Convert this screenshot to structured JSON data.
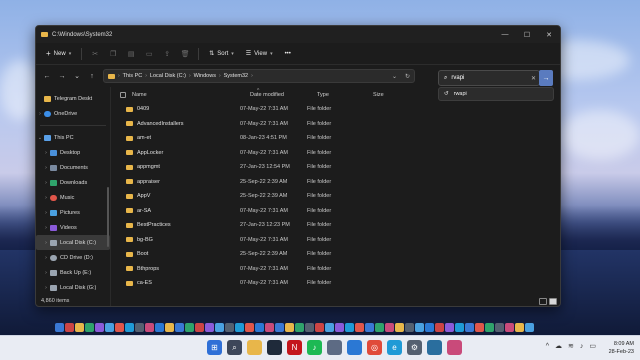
{
  "window": {
    "title": "C:\\Windows\\System32",
    "controls": {
      "minimize": "—",
      "maximize": "☐",
      "close": "✕"
    }
  },
  "toolbar": {
    "new_label": "New",
    "sort_label": "Sort",
    "view_label": "View",
    "more_label": "•••",
    "icons": [
      "cut-icon",
      "copy-icon",
      "paste-icon",
      "rename-icon",
      "share-icon",
      "delete-icon"
    ]
  },
  "address": {
    "segments": [
      "This PC",
      "Local Disk (C:)",
      "Windows",
      "System32"
    ]
  },
  "search": {
    "value": "rvapi",
    "suggestion": "rwapi"
  },
  "sidebar": {
    "items": [
      {
        "label": "Telegram Deskt",
        "color": "#e8b64a"
      },
      {
        "label": "OneDrive",
        "color": "#3b8ee8"
      },
      {
        "label": "This PC",
        "color": "#5aa0e8"
      },
      {
        "label": "Desktop",
        "color": "#4a90d9"
      },
      {
        "label": "Documents",
        "color": "#7a8aa0"
      },
      {
        "label": "Downloads",
        "color": "#2fa36b"
      },
      {
        "label": "Music",
        "color": "#e0564a"
      },
      {
        "label": "Pictures",
        "color": "#4aa0e0"
      },
      {
        "label": "Videos",
        "color": "#8a5ad9"
      },
      {
        "label": "Local Disk (C:)",
        "color": "#9aa4b0"
      },
      {
        "label": "CD Drive (D:)",
        "color": "#9aa4b0"
      },
      {
        "label": "Back Up (E:)",
        "color": "#9aa4b0"
      },
      {
        "label": "Local Disk (G:)",
        "color": "#9aa4b0"
      }
    ],
    "status": "4,860 items"
  },
  "columns": {
    "name": "Name",
    "date": "Date modified",
    "type": "Type",
    "size": "Size"
  },
  "files": [
    {
      "name": "0409",
      "date": "07-May-22 7:31 AM",
      "type": "File folder"
    },
    {
      "name": "AdvancedInstallers",
      "date": "07-May-22 7:31 AM",
      "type": "File folder"
    },
    {
      "name": "am-et",
      "date": "08-Jan-23 4:51 PM",
      "type": "File folder"
    },
    {
      "name": "AppLocker",
      "date": "07-May-22 7:31 AM",
      "type": "File folder"
    },
    {
      "name": "appmgmt",
      "date": "27-Jan-23 12:54 PM",
      "type": "File folder"
    },
    {
      "name": "appraiser",
      "date": "25-Sep-22 2:39 AM",
      "type": "File folder"
    },
    {
      "name": "AppV",
      "date": "25-Sep-22 2:39 AM",
      "type": "File folder"
    },
    {
      "name": "ar-SA",
      "date": "07-May-22 7:31 AM",
      "type": "File folder"
    },
    {
      "name": "BestPractices",
      "date": "27-Jan-23 12:23 PM",
      "type": "File folder"
    },
    {
      "name": "bg-BG",
      "date": "07-May-22 7:31 AM",
      "type": "File folder"
    },
    {
      "name": "Boot",
      "date": "25-Sep-22 2:39 AM",
      "type": "File folder"
    },
    {
      "name": "Bthprops",
      "date": "07-May-22 7:31 AM",
      "type": "File folder"
    },
    {
      "name": "ca-ES",
      "date": "07-May-22 7:31 AM",
      "type": "File folder"
    }
  ],
  "taskbar": {
    "apps": [
      {
        "name": "start-icon",
        "color": "#2f6fd6",
        "glyph": "⊞"
      },
      {
        "name": "search-icon",
        "color": "#3d4659",
        "glyph": "⌕"
      },
      {
        "name": "explorer-icon",
        "color": "#e8b64a",
        "glyph": ""
      },
      {
        "name": "media-icon",
        "color": "#1f2a3a",
        "glyph": ""
      },
      {
        "name": "netflix-icon",
        "color": "#c4161c",
        "glyph": "N"
      },
      {
        "name": "spotify-icon",
        "color": "#1db954",
        "glyph": "♪"
      },
      {
        "name": "files-icon",
        "color": "#5d6b84",
        "glyph": ""
      },
      {
        "name": "store-icon",
        "color": "#2b78d4",
        "glyph": ""
      },
      {
        "name": "chrome-icon",
        "color": "#e04a3a",
        "glyph": "◎"
      },
      {
        "name": "edge-icon",
        "color": "#1f9ad6",
        "glyph": "e"
      },
      {
        "name": "settings-icon",
        "color": "#556070",
        "glyph": "⚙"
      },
      {
        "name": "vpn-icon",
        "color": "#2a6e9e",
        "glyph": ""
      },
      {
        "name": "photos-icon",
        "color": "#c94a7a",
        "glyph": ""
      }
    ],
    "time": "8:09 AM",
    "date": "28-Feb-23"
  }
}
